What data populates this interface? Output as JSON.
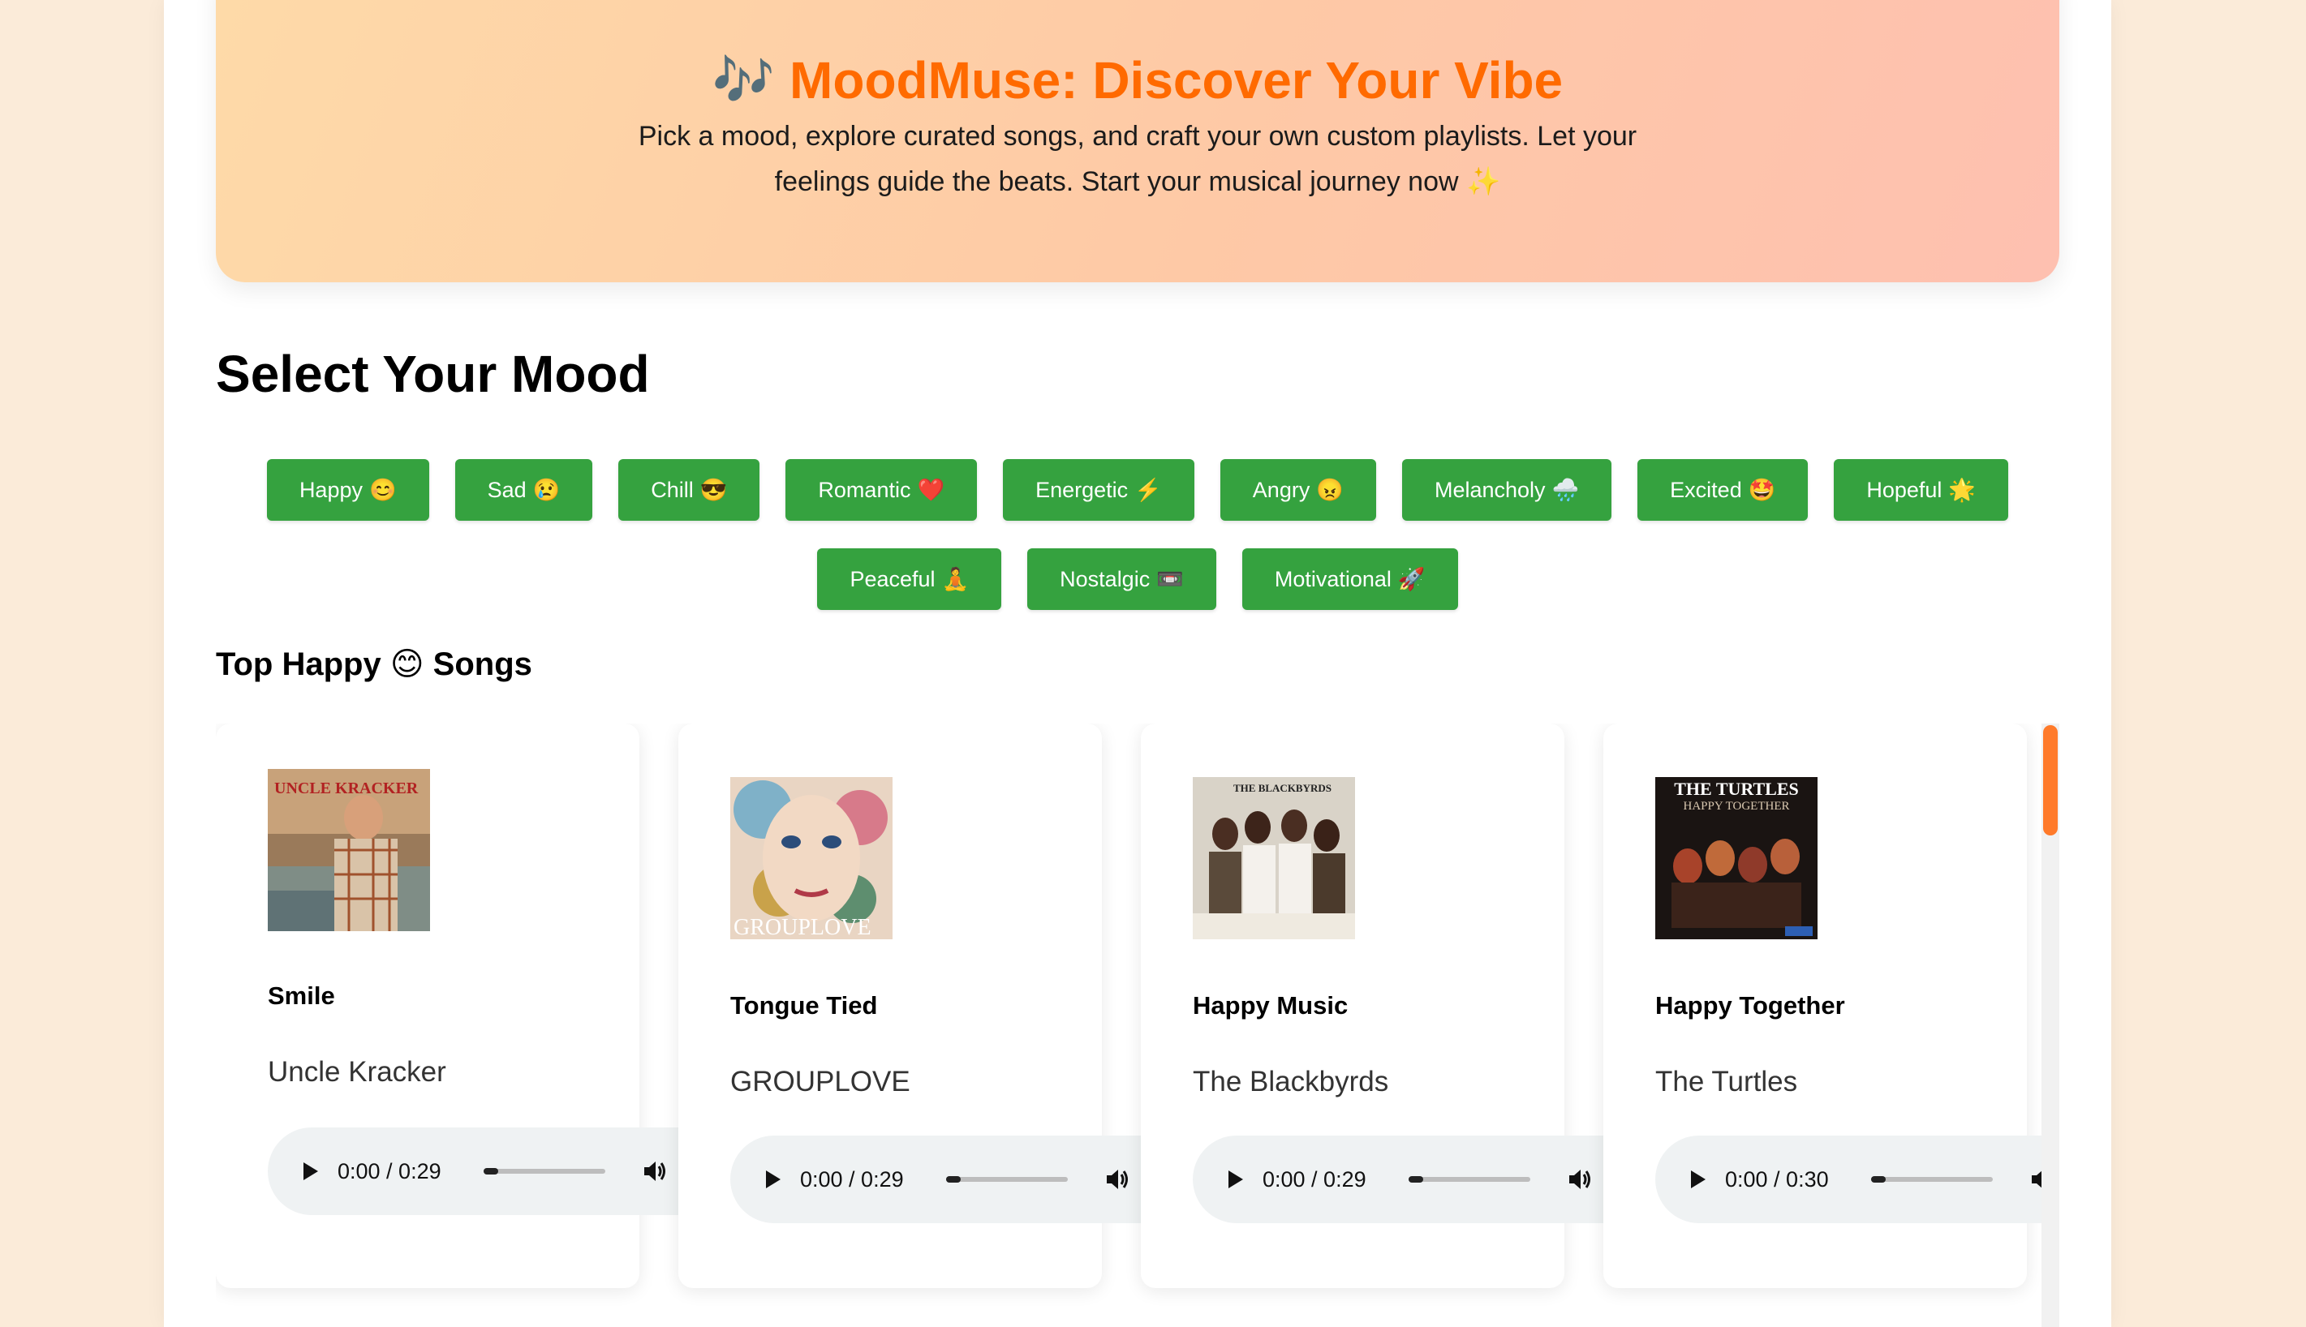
{
  "hero": {
    "icon": "musical-notes-icon",
    "notes_glyph": "🎶",
    "title": "MoodMuse: Discover Your Vibe",
    "subtitle": "Pick a mood, explore curated songs, and craft your own custom playlists. Let your feelings guide the beats. Start your musical journey now",
    "sparkle": "✨"
  },
  "colors": {
    "accent": "#ff6a00",
    "mood_button": "#35a23f",
    "scroll_thumb": "#ff7a2a"
  },
  "mood_section": {
    "title": "Select Your Mood",
    "moods_row1": [
      {
        "label": "Happy",
        "emoji": "😊"
      },
      {
        "label": "Sad",
        "emoji": "😢"
      },
      {
        "label": "Chill",
        "emoji": "😎"
      },
      {
        "label": "Romantic",
        "emoji": "❤️"
      },
      {
        "label": "Energetic",
        "emoji": "⚡"
      },
      {
        "label": "Angry",
        "emoji": "😠"
      },
      {
        "label": "Melancholy",
        "emoji": "🌧️"
      },
      {
        "label": "Excited",
        "emoji": "🤩"
      },
      {
        "label": "Hopeful",
        "emoji": "🌟"
      }
    ],
    "moods_row2": [
      {
        "label": "Peaceful",
        "emoji": "🧘"
      },
      {
        "label": "Nostalgic",
        "emoji": "📼"
      },
      {
        "label": "Motivational",
        "emoji": "🚀"
      }
    ]
  },
  "songs_section": {
    "title_prefix": "Top Happy",
    "title_emoji": "😊",
    "title_suffix": "Songs",
    "songs": [
      {
        "title": "Smile",
        "artist": "Uncle Kracker",
        "time": "0:00 / 0:29",
        "cover_text": "UNCLE KRACKER"
      },
      {
        "title": "Tongue Tied",
        "artist": "GROUPLOVE",
        "time": "0:00 / 0:29",
        "cover_text": "GROUPLOVE"
      },
      {
        "title": "Happy Music",
        "artist": "The Blackbyrds",
        "time": "0:00 / 0:29",
        "cover_text": "THE BLACKBYRDS"
      },
      {
        "title": "Happy Together",
        "artist": "The Turtles",
        "time": "0:00 / 0:30",
        "cover_text": "THE TURTLES",
        "cover_subtext": "HAPPY TOGETHER"
      }
    ]
  }
}
